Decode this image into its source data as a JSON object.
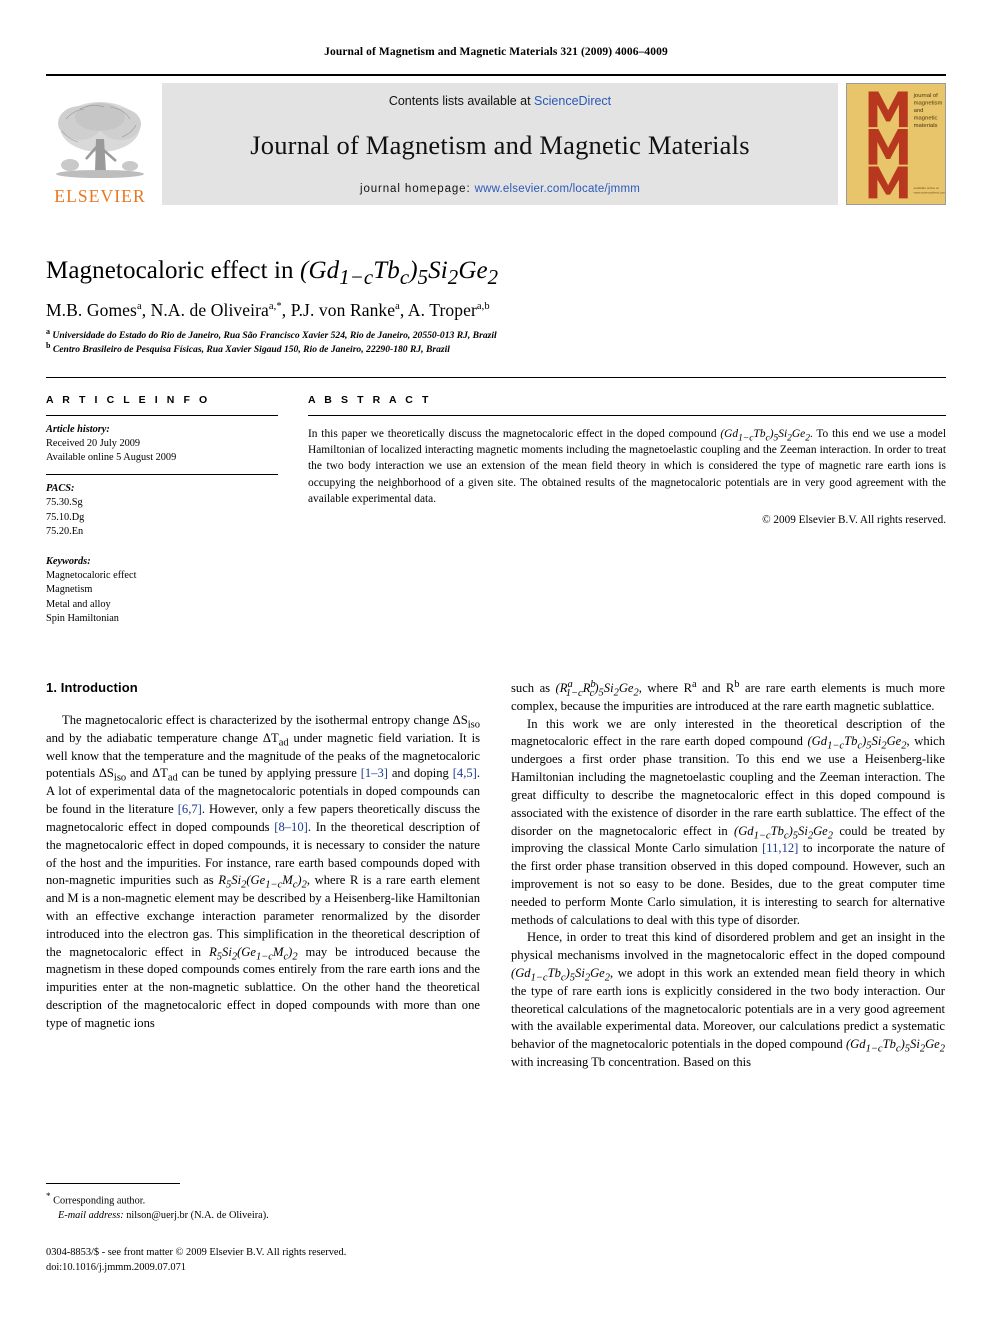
{
  "running_head": "Journal of Magnetism and Magnetic Materials 321 (2009) 4006–4009",
  "masthead": {
    "elsevier_wordmark": "ELSEVIER",
    "contents_prefix": "Contents lists available at ",
    "contents_link": "ScienceDirect",
    "journal_name": "Journal of Magnetism and Magnetic Materials",
    "homepage_prefix": "journal homepage: ",
    "homepage_link": "www.elsevier.com/locate/jmmm",
    "cover": {
      "lines": [
        "journal of",
        "magnetism",
        "and",
        "magnetic",
        "materials"
      ],
      "bg_color": "#e8c46a",
      "letter_color": "#b7381f",
      "letters": "MMM"
    }
  },
  "title": {
    "plain": "Magnetocaloric effect in ",
    "formula_open": "(Gd",
    "formula_sub1": "1−c",
    "formula_tb": "Tb",
    "formula_subc": "c",
    "formula_close": ")",
    "formula_sub5": "5",
    "formula_si": "Si",
    "formula_sub2a": "2",
    "formula_ge": "Ge",
    "formula_sub2b": "2"
  },
  "authors": {
    "list": [
      {
        "name": "M.B. Gomes",
        "marks": "a"
      },
      {
        "name": "N.A. de Oliveira",
        "marks": "a,*"
      },
      {
        "name": "P.J. von Ranke",
        "marks": "a"
      },
      {
        "name": "A. Troper",
        "marks": "a,b"
      }
    ]
  },
  "affiliations": [
    {
      "mark": "a",
      "text": "Universidade do Estado do Rio de Janeiro, Rua São Francisco Xavier 524, Rio de Janeiro, 20550-013 RJ, Brazil"
    },
    {
      "mark": "b",
      "text": "Centro Brasileiro de Pesquisa Físicas, Rua Xavier Sigaud 150, Rio de Janeiro, 22290-180 RJ, Brazil"
    }
  ],
  "article_info": {
    "heading": "A R T I C L E  I N F O",
    "history_label": "Article history:",
    "history": [
      "Received 20 July 2009",
      "Available online 5 August 2009"
    ],
    "pacs_label": "PACS:",
    "pacs": [
      "75.30.Sg",
      "75.10.Dg",
      "75.20.En"
    ],
    "keywords_label": "Keywords:",
    "keywords": [
      "Magnetocaloric effect",
      "Magnetism",
      "Metal and alloy",
      "Spin Hamiltonian"
    ]
  },
  "abstract": {
    "heading": "A B S T R A C T",
    "part1": "In this paper we theoretically discuss the magnetocaloric effect in the doped compound ",
    "part2": ". To this end we use a model Hamiltonian of localized interacting magnetic moments including the magnetoelastic coupling and the Zeeman interaction. In order to treat the two body interaction we use an extension of the mean field theory in which is considered the type of magnetic rare earth ions is occupying the neighborhood of a given site. The obtained results of the magnetocaloric potentials are in very good agreement with the available experimental data.",
    "copyright": "© 2009 Elsevier B.V. All rights reserved."
  },
  "body": {
    "section_number_title": "1.  Introduction",
    "left": {
      "p1_a": "The magnetocaloric effect is characterized by the isothermal entropy change ΔS",
      "p1_sub1": "iso",
      "p1_b": " and by the adiabatic temperature change ΔT",
      "p1_sub2": "ad",
      "p1_c": " under magnetic field variation. It is well know that the temperature and the magnitude of the peaks of the magnetocaloric potentials ΔS",
      "p1_sub3": "iso",
      "p1_d": " and ΔT",
      "p1_sub4": "ad",
      "p1_e": " can be tuned by applying pressure ",
      "p1_cite1": "[1–3]",
      "p1_f": " and doping ",
      "p1_cite2": "[4,5]",
      "p1_g": ". A lot of experimental data of the magnetocaloric potentials in doped compounds can be found in the literature ",
      "p1_cite3": "[6,7]",
      "p1_h": ". However, only a few papers theoretically discuss the magnetocaloric effect in doped compounds ",
      "p1_cite4": "[8–10]",
      "p1_i": ". In the theoretical description of the magnetocaloric effect in doped compounds, it is necessary to consider the nature of the host and the impurities. For instance, rare earth based compounds doped with non-magnetic impurities such as ",
      "p1_j": ", where R is a rare earth element and M is a non-magnetic element may be described by a Heisenberg-like Hamiltonian with an effective exchange interaction parameter renormalized by the disorder introduced into the electron gas. This simplification in the theoretical description of the magnetocaloric effect in ",
      "p1_k": " may be introduced because the magnetism in these doped compounds comes entirely from the rare earth ions and the impurities enter at the non-magnetic sublattice. On the other hand the theoretical description of the magnetocaloric effect in doped compounds with more than one type of magnetic ions"
    },
    "right": {
      "p2_a": "such as ",
      "p2_b": ", where R",
      "p2_sup1": "a",
      "p2_c": " and R",
      "p2_sup2": "b",
      "p2_d": " are rare earth elements is much more complex, because the impurities are introduced at the rare earth magnetic sublattice.",
      "p3_a": "In this work we are only interested in the theoretical description of the magnetocaloric effect in the rare earth doped compound ",
      "p3_b": ", which undergoes a first order phase transition. To this end we use a Heisenberg-like Hamiltonian including the magnetoelastic coupling and the Zeeman interaction. The great difficulty to describe the magnetocaloric effect in this doped compound is associated with the existence of disorder in the rare earth sublattice. The effect of the disorder on the magnetocaloric effect in ",
      "p3_c": " could be treated by improving the classical Monte Carlo simulation ",
      "p3_cite": "[11,12]",
      "p3_d": " to incorporate the nature of the first order phase transition observed in this doped compound. However, such an improvement is not so easy to be done. Besides, due to the great computer time needed to perform Monte Carlo simulation, it is interesting to search for alternative methods of calculations to deal with this type of disorder.",
      "p4_a": "Hence, in order to treat this kind of disordered problem and get an insight in the physical mechanisms involved in the magnetocaloric effect in the doped compound ",
      "p4_b": ", we adopt in this work an extended mean field theory in which the type of rare earth ions is explicitly considered in the two body interaction. Our theoretical calculations of the magnetocaloric potentials are in a very good agreement with the available experimental data. Moreover, our calculations predict a systematic behavior of the magnetocaloric potentials in the doped compound ",
      "p4_c": " with increasing Tb concentration. Based on this"
    }
  },
  "footnotes": {
    "corresponding": "Corresponding author.",
    "email_label": "E-mail address:",
    "email": " nilson@uerj.br (N.A. de Oliveira)."
  },
  "imprint": {
    "line1": "0304-8853/$ - see front matter © 2009 Elsevier B.V. All rights reserved.",
    "line2": "doi:10.1016/j.jmmm.2009.07.071"
  }
}
